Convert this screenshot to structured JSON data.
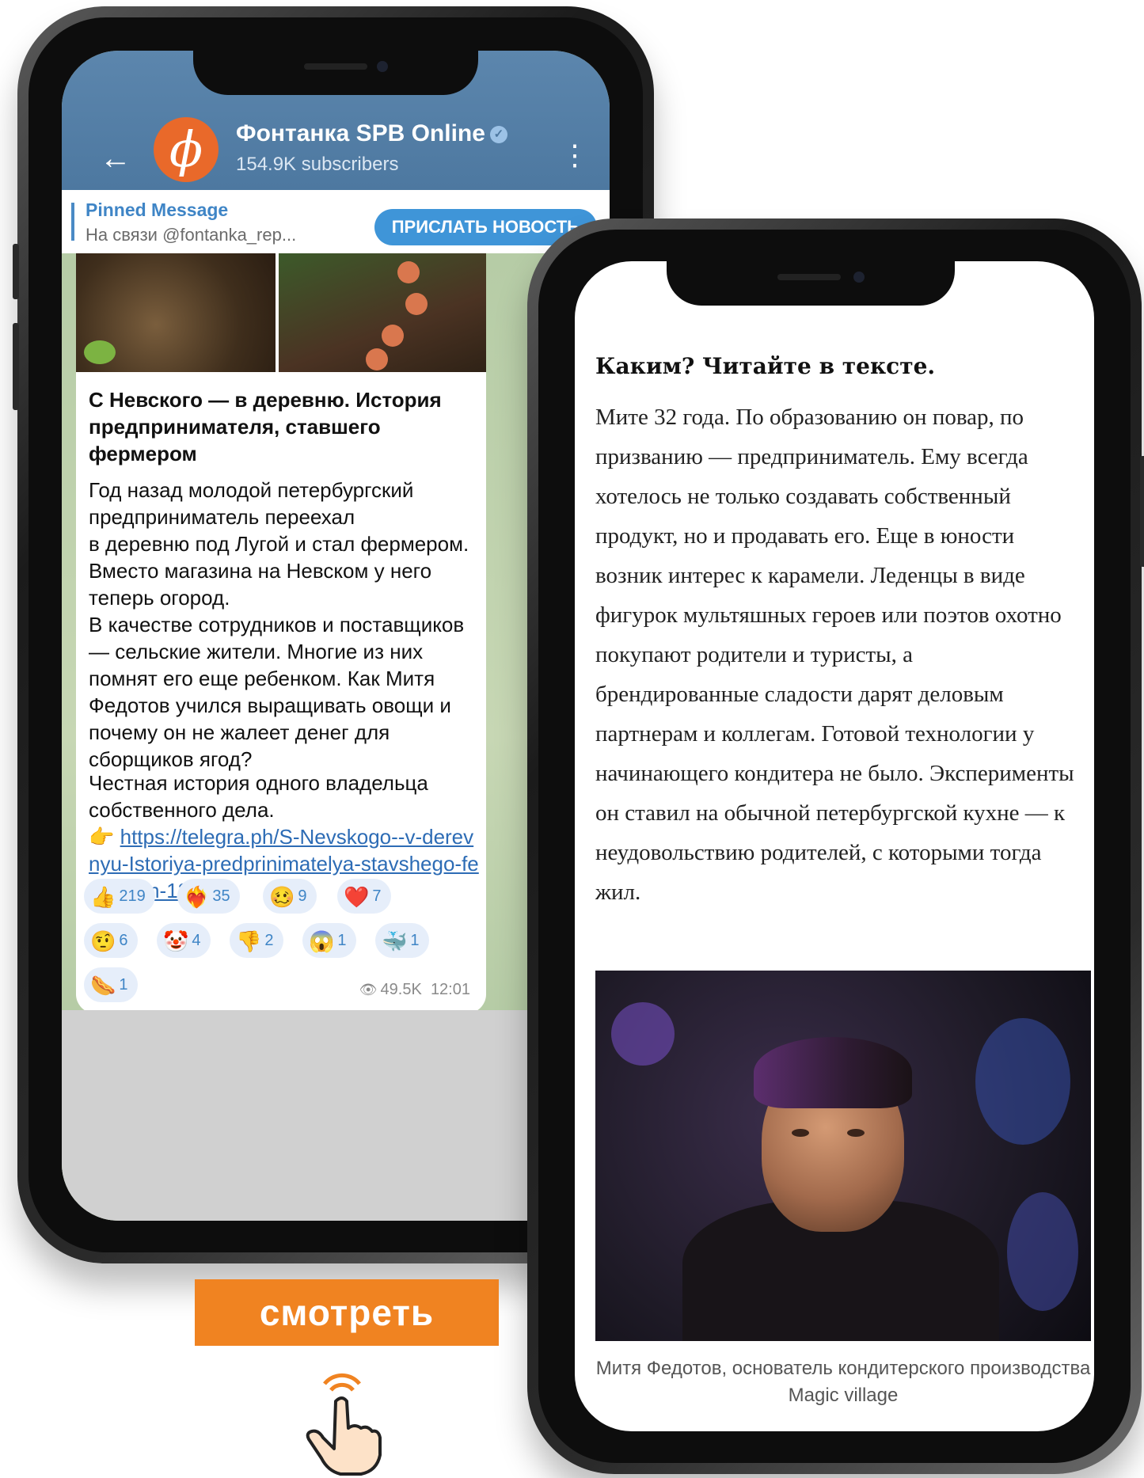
{
  "telegram": {
    "channel_name": "Фонтанка SPB Online",
    "subscribers": "154.9K subscribers",
    "pinned_title": "Pinned Message",
    "pinned_text": "На связи @fontanka_rep...",
    "send_news_button": "ПРИСЛАТЬ НОВОСТЬ",
    "post": {
      "title": "С Невского — в деревню. История предпринимателя, ставшего фермером",
      "body": "Год назад молодой петербургский предприниматель переехал\nв деревню под Лугой и стал фермером. Вместо магазина на Невском у него теперь огород.\nВ качестве сотрудников и поставщиков — сельские жители. Многие из них помнят его еще ребенком. Как Митя Федотов учился выращивать овощи и почему он не жалеет денег для сборщиков ягод?",
      "extra": "Честная история одного владельца собственного дела.",
      "link_emoji": "👉",
      "link": "https://telegra.ph/S-Nevskogo--v-derevnyu-Istoriya-predprinimatelya-stavshego-fermerom-12-09",
      "views": "49.5K",
      "time": "12:01"
    },
    "reactions": [
      {
        "emoji": "👍",
        "count": "219"
      },
      {
        "emoji": "❤️‍🔥",
        "count": "35"
      },
      {
        "emoji": "🥴",
        "count": "9"
      },
      {
        "emoji": "❤️",
        "count": "7"
      },
      {
        "emoji": "🤨",
        "count": "6"
      },
      {
        "emoji": "🤡",
        "count": "4"
      },
      {
        "emoji": "👎",
        "count": "2"
      },
      {
        "emoji": "😱",
        "count": "1"
      },
      {
        "emoji": "🐳",
        "count": "1"
      },
      {
        "emoji": "🌭",
        "count": "1"
      }
    ]
  },
  "cta": {
    "label": "смотреть"
  },
  "article": {
    "heading": "Каким? Читайте в тексте.",
    "text": "Мите 32 года. По образованию он повар, по призванию — предприниматель. Ему всегда хотелось не только создавать собственный продукт, но и продавать его. Еще в юности возник интерес к карамели. Леденцы в виде фигурок мультяшных героев или поэтов охотно покупают родители и туристы, а брендированные сладости дарят деловым партнерам и коллегам. Готовой технологии у начинающего кондитера не было. Эксперименты он ставил на обычной петербургской кухне — к неудовольствию родителей, с которыми тогда жил.",
    "caption": "Митя Федотов, основатель кондитерского производства Magic village"
  },
  "colors": {
    "telegram_header": "#4d78a0",
    "link": "#2d6cb5",
    "cta": "#f08321",
    "reaction_bg": "#e6eefa"
  }
}
